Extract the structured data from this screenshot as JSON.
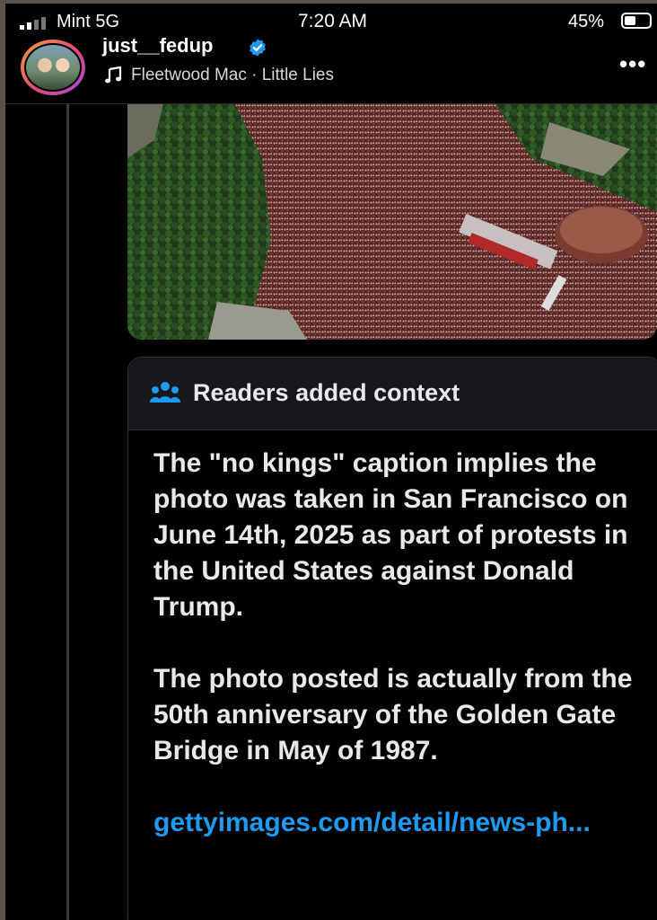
{
  "status_bar": {
    "carrier": "Mint  5G",
    "time": "7:20 AM",
    "battery_percent": "45%",
    "battery_level": 0.45
  },
  "post": {
    "username": "just__fedup",
    "song": "Fleetwood Mac · Little Lies",
    "more_label": "•••"
  },
  "context_note": {
    "title": "Readers added context",
    "paragraph1": "The \"no kings\" caption implies the photo was taken in San Francisco on June 14th, 2025 as part of protests in the United States against Donald Trump.",
    "paragraph2": "The photo posted is actually from the 50th anniversary of the Golden Gate Bridge in May of 1987.",
    "link": "gettyimages.com/detail/news-ph..."
  },
  "colors": {
    "accent": "#1d9bf0",
    "verified": "#1d9bf0",
    "text": "#e7e9ea",
    "background": "#000000"
  }
}
